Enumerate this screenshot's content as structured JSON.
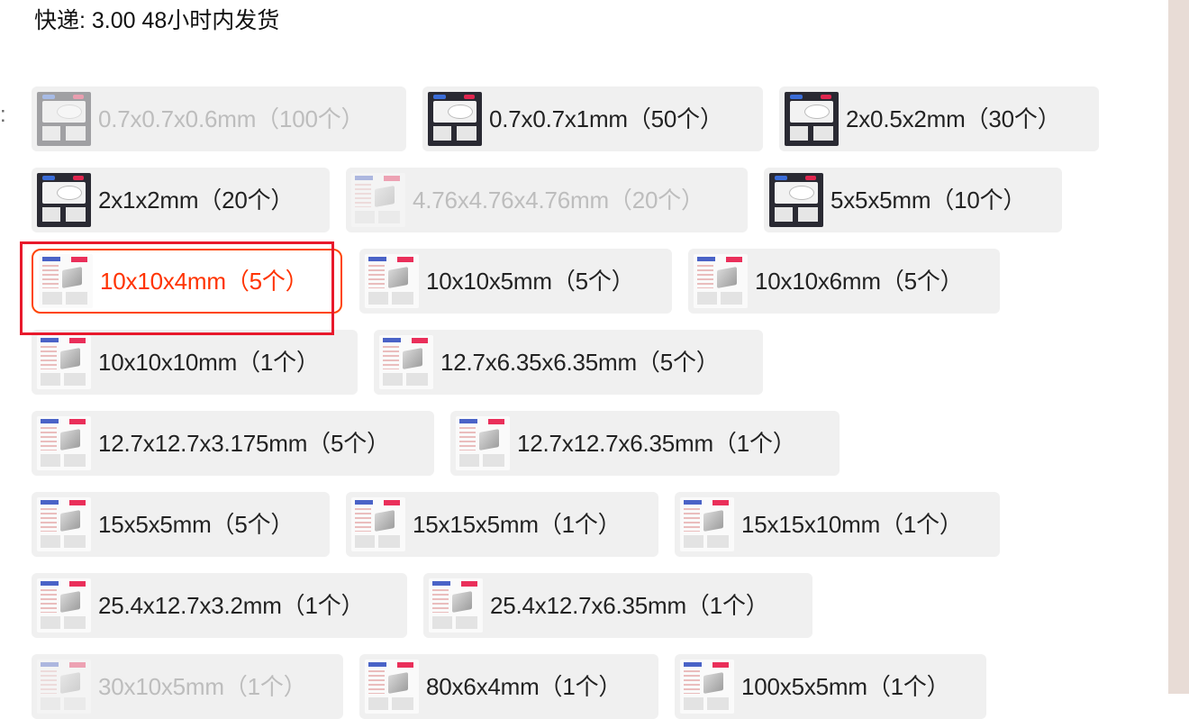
{
  "shipping": {
    "text": "快递: 3.00  48小时内发货"
  },
  "option_group": {
    "label": ":"
  },
  "options": [
    {
      "label": "0.7x0.7x0.6mm（100个）",
      "state": "disabled",
      "thumb": "dark"
    },
    {
      "label": "0.7x0.7x1mm（50个）",
      "state": "normal",
      "thumb": "dark"
    },
    {
      "label": "2x0.5x2mm（30个）",
      "state": "normal",
      "thumb": "dark"
    },
    {
      "label": "2x1x2mm（20个）",
      "state": "normal",
      "thumb": "dark"
    },
    {
      "label": "4.76x4.76x4.76mm（20个）",
      "state": "disabled",
      "thumb": "light"
    },
    {
      "label": "5x5x5mm（10个）",
      "state": "normal",
      "thumb": "dark"
    },
    {
      "label": "10x10x4mm（5个）",
      "state": "selected",
      "thumb": "light"
    },
    {
      "label": "10x10x5mm（5个）",
      "state": "normal",
      "thumb": "light"
    },
    {
      "label": "10x10x6mm（5个）",
      "state": "normal",
      "thumb": "light"
    },
    {
      "label": "10x10x10mm（1个）",
      "state": "normal",
      "thumb": "light"
    },
    {
      "label": "12.7x6.35x6.35mm（5个）",
      "state": "normal",
      "thumb": "light"
    },
    {
      "label": "12.7x12.7x3.175mm（5个）",
      "state": "normal",
      "thumb": "light"
    },
    {
      "label": "12.7x12.7x6.35mm（1个）",
      "state": "normal",
      "thumb": "light"
    },
    {
      "label": "15x5x5mm（5个）",
      "state": "normal",
      "thumb": "light"
    },
    {
      "label": "15x15x5mm（1个）",
      "state": "normal",
      "thumb": "light"
    },
    {
      "label": "15x15x10mm（1个）",
      "state": "normal",
      "thumb": "light"
    },
    {
      "label": "25.4x12.7x3.2mm（1个）",
      "state": "normal",
      "thumb": "light"
    },
    {
      "label": "25.4x12.7x6.35mm（1个）",
      "state": "normal",
      "thumb": "light"
    },
    {
      "label": "30x10x5mm（1个）",
      "state": "disabled",
      "thumb": "light"
    },
    {
      "label": "80x6x4mm（1个）",
      "state": "normal",
      "thumb": "light"
    },
    {
      "label": "100x5x5mm（1个）",
      "state": "normal",
      "thumb": "light"
    }
  ],
  "colors": {
    "accent": "#ff4400",
    "highlight_box": "#e8192c",
    "chip_bg": "#f0f0f0",
    "disabled_text": "#bdbdbd"
  }
}
